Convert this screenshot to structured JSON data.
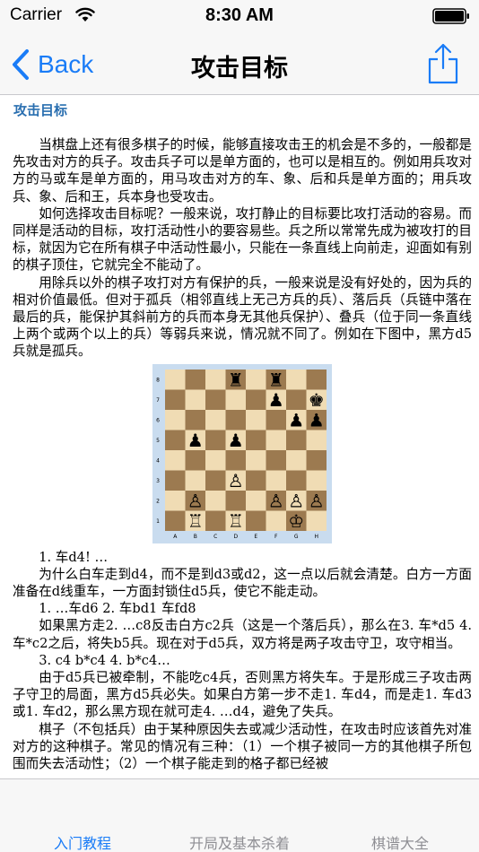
{
  "status": {
    "carrier": "Carrier",
    "time": "8:30 AM"
  },
  "nav": {
    "back_label": "Back",
    "title": "攻击目标"
  },
  "content": {
    "heading": "攻击目标",
    "paragraphs_before": [
      "当棋盘上还有很多棋子的时候，能够直接攻击王的机会是不多的，一般都是先攻击对方的兵子。攻击兵子可以是单方面的，也可以是相互的。例如用兵攻对方的马或车是单方面的，用马攻击对方的车、象、后和兵是单方面的；用兵攻兵、象、后和王，兵本身也受攻击。",
      "如何选择攻击目标呢？一般来说，攻打静止的目标要比攻打活动的容易。而同样是活动的目标，攻打活动性小的要容易些。兵之所以常常先成为被攻打的目标，就因为它在所有棋子中活动性最小，只能在一条直线上向前走，迎面如有别的棋子顶住，它就完全不能动了。",
      "用除兵以外的棋子攻打对方有保护的兵，一般来说是没有好处的，因为兵的相对价值最低。但对于孤兵（相邻直线上无己方兵的兵）、落后兵（兵链中落在最后的兵，能保护其斜前方的兵而本身无其他兵保护）、叠兵（位于同一条直线上两个或两个以上的兵）等弱兵来说，情况就不同了。例如在下图中，黑方d5兵就是孤兵。"
    ],
    "board": {
      "files": [
        "A",
        "B",
        "C",
        "D",
        "E",
        "F",
        "G",
        "H"
      ],
      "ranks": [
        "8",
        "7",
        "6",
        "5",
        "4",
        "3",
        "2",
        "1"
      ],
      "pieces": [
        {
          "square": "d8",
          "glyph": "♜"
        },
        {
          "square": "f8",
          "glyph": "♜"
        },
        {
          "square": "f7",
          "glyph": "♟"
        },
        {
          "square": "h7",
          "glyph": "♚"
        },
        {
          "square": "g6",
          "glyph": "♟"
        },
        {
          "square": "h6",
          "glyph": "♟"
        },
        {
          "square": "b5",
          "glyph": "♟"
        },
        {
          "square": "d5",
          "glyph": "♟"
        },
        {
          "square": "d3",
          "glyph": "♙"
        },
        {
          "square": "b2",
          "glyph": "♙"
        },
        {
          "square": "f2",
          "glyph": "♙"
        },
        {
          "square": "g2",
          "glyph": "♙"
        },
        {
          "square": "h2",
          "glyph": "♙"
        },
        {
          "square": "b1",
          "glyph": "♖"
        },
        {
          "square": "d1",
          "glyph": "♖"
        },
        {
          "square": "g1",
          "glyph": "♔"
        }
      ]
    },
    "paragraphs_after": [
      {
        "text": "1. 车d4! …",
        "noindent": true
      },
      {
        "text": "为什么白车走到d4，而不是到d3或d2，这一点以后就会清楚。白方一方面准备在d线重车，一方面封锁住d5兵，使它不能走动。",
        "noindent": false
      },
      {
        "text": "1. …车d6  2. 车bd1 车fd8",
        "noindent": true
      },
      {
        "text": "如果黑方走2. …c8反击白方c2兵（这是一个落后兵），那么在3. 车*d5 4. 车*c2之后，将失b5兵。现在对于d5兵，双方将是两子攻击守卫，攻守相当。",
        "noindent": false
      },
      {
        "text": "3. c4 b*c4  4. b*c4…",
        "noindent": true
      },
      {
        "text": "由于d5兵已被牵制，不能吃c4兵，否则黑方将失车。于是形成三子攻击两子守卫的局面，黑方d5兵必失。如果白方第一步不走1. 车d4，而是走1. 车d3或1. 车d2，那么黑方现在就可走4. …d4，避免了失兵。",
        "noindent": false
      },
      {
        "text": "棋子（不包括兵）由于某种原因失去或减少活动性，在攻击时应该首先对准对方的这种棋子。常见的情况有三种：（1）一个棋子被同一方的其他棋子所包围而失去活动性；（2）一个棋子能走到的格子都已经被",
        "noindent": false
      }
    ]
  },
  "tabs": [
    {
      "label": "入门教程",
      "active": true
    },
    {
      "label": "开局及基本杀着",
      "active": false
    },
    {
      "label": "棋谱大全",
      "active": false
    }
  ],
  "colors": {
    "accent": "#1a7cf7",
    "heading": "#2a6fb0",
    "light_square": "#f0dcb4",
    "dark_square": "#9c7a50"
  }
}
